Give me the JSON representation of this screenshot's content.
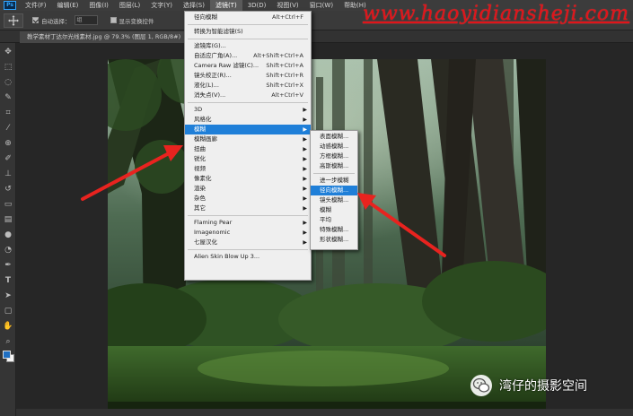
{
  "menubar": {
    "logo": "Ps",
    "items": [
      "文件(F)",
      "编辑(E)",
      "图像(I)",
      "图层(L)",
      "文字(Y)",
      "选择(S)",
      "滤镜(T)",
      "3D(D)",
      "视图(V)",
      "窗口(W)",
      "帮助(H)"
    ],
    "active_index": 6
  },
  "options": {
    "auto_select_label": "自动选择：",
    "auto_select_value": "组",
    "show_transform_label": "显示变换控件"
  },
  "watermark_url": "www.haoyidiansheji.com",
  "document_tab": "教学素材丁达尔光线素材.jpg @ 79.3% (图层 1, RGB/8#)",
  "filter_menu": {
    "top_items": [
      {
        "label": "径向模糊",
        "shortcut": "Alt+Ctrl+F"
      },
      {
        "label": "转换为智能滤镜(S)",
        "shortcut": ""
      }
    ],
    "mid_items": [
      {
        "label": "滤镜库(G)...",
        "shortcut": ""
      },
      {
        "label": "自适应广角(A)...",
        "shortcut": "Alt+Shift+Ctrl+A"
      },
      {
        "label": "Camera Raw 滤镜(C)...",
        "shortcut": "Shift+Ctrl+A"
      },
      {
        "label": "镜头校正(R)...",
        "shortcut": "Shift+Ctrl+R"
      },
      {
        "label": "液化(L)...",
        "shortcut": "Shift+Ctrl+X"
      },
      {
        "label": "消失点(V)...",
        "shortcut": "Alt+Ctrl+V"
      }
    ],
    "sub_items": [
      "3D",
      "风格化",
      "模糊",
      "模糊画廊",
      "扭曲",
      "锐化",
      "视频",
      "像素化",
      "渲染",
      "杂色",
      "其它"
    ],
    "highlighted": "模糊",
    "plugin_items": [
      "Flaming Pear",
      "Imagenomic",
      "七屋汉化"
    ],
    "last_item": "Alien Skin Blow Up 3..."
  },
  "blur_submenu": {
    "items": [
      "表面模糊...",
      "动感模糊...",
      "方框模糊...",
      "高斯模糊...",
      "进一步模糊",
      "径向模糊...",
      "镜头模糊...",
      "模糊",
      "平均",
      "特殊模糊...",
      "形状模糊..."
    ],
    "highlighted": "径向模糊..."
  },
  "wechat": {
    "icon": "wechat-icon",
    "text": "湾仔的摄影空间"
  },
  "colors": {
    "watermark_red": "#e0141a",
    "menu_highlight": "#1f7fd8",
    "arrow_red": "#e8231f",
    "foreground_swatch": "#1f6fc2"
  }
}
